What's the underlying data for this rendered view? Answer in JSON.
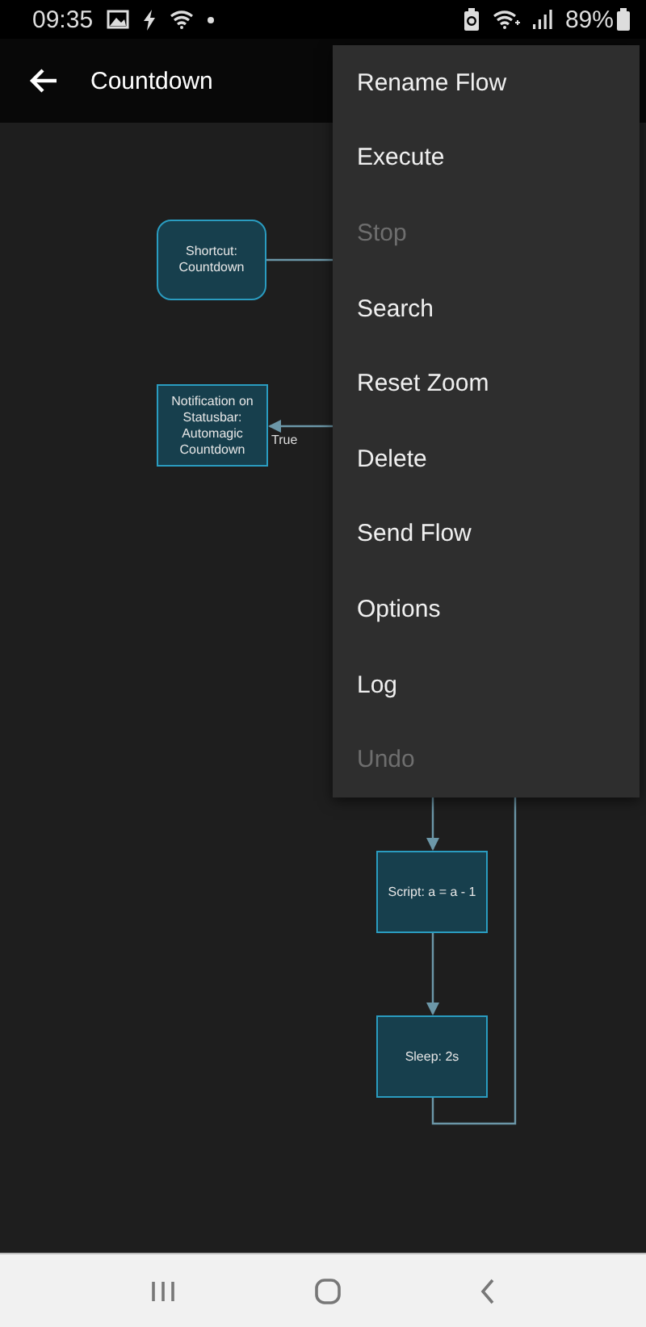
{
  "status_bar": {
    "time": "09:35",
    "battery": "89%"
  },
  "app_bar": {
    "title": "Countdown"
  },
  "flow": {
    "nodes": [
      {
        "label": "Shortcut: Countdown",
        "kind": "trigger"
      },
      {
        "label": "Notification on Statusbar: Automagic Countdown",
        "kind": "action"
      },
      {
        "label": "Script: a = a - 1",
        "kind": "action"
      },
      {
        "label": "Sleep: 2s",
        "kind": "action"
      }
    ],
    "edge_label": "True"
  },
  "menu": {
    "items": [
      {
        "label": "Rename Flow",
        "disabled": false
      },
      {
        "label": "Execute",
        "disabled": false
      },
      {
        "label": "Stop",
        "disabled": true
      },
      {
        "label": "Search",
        "disabled": false
      },
      {
        "label": "Reset Zoom",
        "disabled": false
      },
      {
        "label": "Delete",
        "disabled": false
      },
      {
        "label": "Send Flow",
        "disabled": false
      },
      {
        "label": "Options",
        "disabled": false
      },
      {
        "label": "Log",
        "disabled": false
      },
      {
        "label": "Undo",
        "disabled": true
      }
    ]
  }
}
